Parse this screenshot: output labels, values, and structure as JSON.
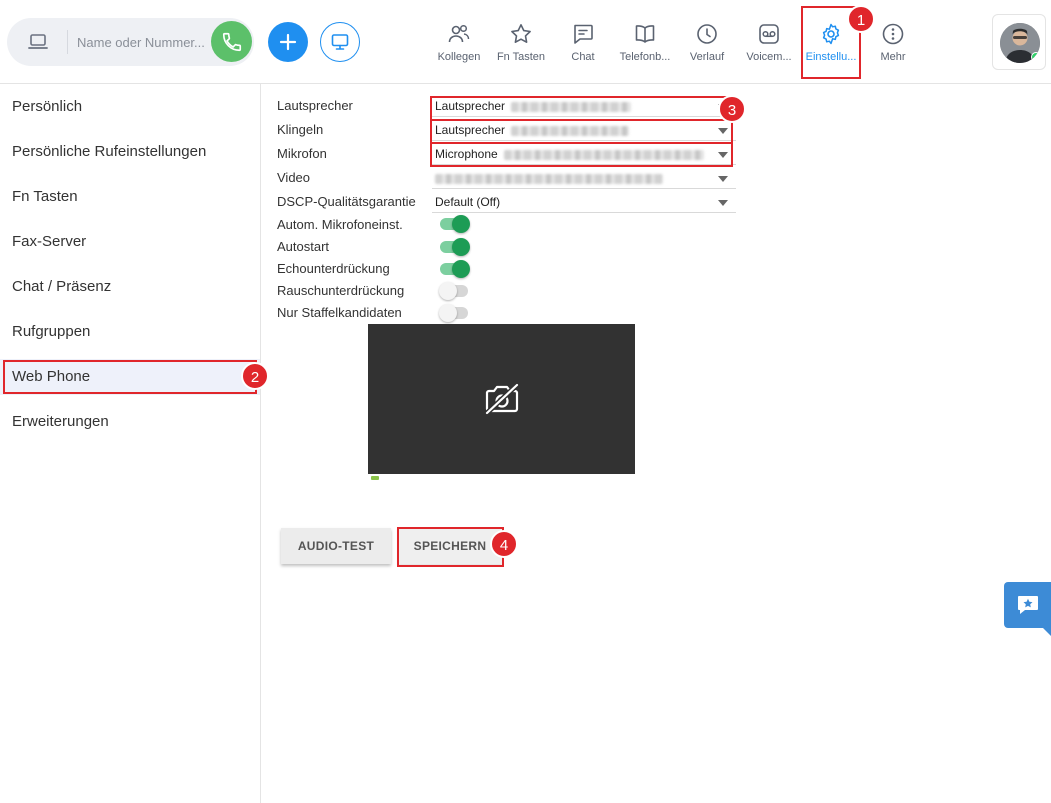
{
  "topbar": {
    "dial_placeholder": "Name oder Nummer...",
    "nav": [
      {
        "label": "Kollegen",
        "icon": "colleagues-icon"
      },
      {
        "label": "Fn Tasten",
        "icon": "star-icon"
      },
      {
        "label": "Chat",
        "icon": "chat-icon"
      },
      {
        "label": "Telefonb...",
        "icon": "phonebook-icon"
      },
      {
        "label": "Verlauf",
        "icon": "clock-icon"
      },
      {
        "label": "Voicem...",
        "icon": "voicemail-icon"
      },
      {
        "label": "Einstellu...",
        "icon": "gear-icon",
        "active": true
      },
      {
        "label": "Mehr",
        "icon": "more-icon"
      }
    ]
  },
  "badges": [
    "1",
    "2",
    "3",
    "4"
  ],
  "sidebar": {
    "items": [
      {
        "label": "Persönlich"
      },
      {
        "label": "Persönliche Rufeinstellungen"
      },
      {
        "label": "Fn Tasten"
      },
      {
        "label": "Fax-Server"
      },
      {
        "label": "Chat / Präsenz"
      },
      {
        "label": "Rufgruppen"
      },
      {
        "label": "Web Phone",
        "active": true
      },
      {
        "label": "Erweiterungen"
      }
    ]
  },
  "settings": {
    "speaker": {
      "label": "Lautsprecher",
      "value": "Lautsprecher"
    },
    "ringing": {
      "label": "Klingeln",
      "value": "Lautsprecher"
    },
    "microphone": {
      "label": "Mikrofon",
      "value": "Microphone"
    },
    "video": {
      "label": "Video",
      "value": ""
    },
    "dscp": {
      "label": "DSCP-Qualitätsgarantie",
      "value": "Default (Off)"
    },
    "toggles": [
      {
        "label": "Autom. Mikrofoneinst.",
        "on": true
      },
      {
        "label": "Autostart",
        "on": true
      },
      {
        "label": "Echounterdrückung",
        "on": true
      },
      {
        "label": "Rauschunterdrückung",
        "on": false
      },
      {
        "label": "Nur Staffelkandidaten",
        "on": false
      }
    ]
  },
  "buttons": {
    "audio_test": "AUDIO-TEST",
    "save": "SPEICHERN"
  },
  "colors": {
    "accent": "#1f8ff0",
    "call_green": "#5cc06a",
    "highlight_red": "#e0262b",
    "toggle_on": "#1d9c55"
  }
}
